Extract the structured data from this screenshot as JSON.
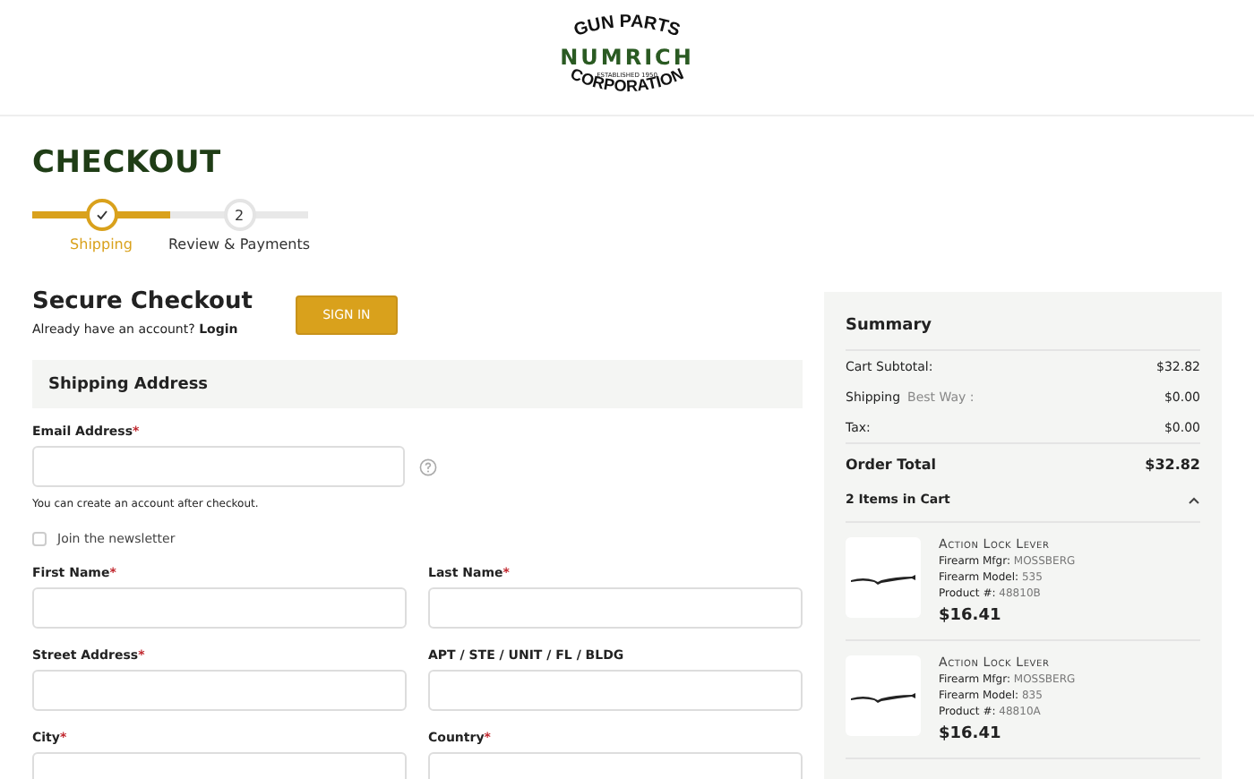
{
  "logo": {
    "top": "GUN PARTS",
    "middle": "NUMRICH",
    "small": "ESTABLISHED 1950",
    "bottom": "CORPORATION"
  },
  "page_title": "CHECKOUT",
  "required_mark": "*",
  "steps": [
    {
      "label": "Shipping",
      "selected": true,
      "done": true
    },
    {
      "label": "Review & Payments",
      "number": "2",
      "selected": false,
      "done": false
    }
  ],
  "secure": {
    "title": "Secure Checkout",
    "prompt": "Already have an account?",
    "link": "Login",
    "button": "SIGN IN"
  },
  "section_title": "Shipping Address",
  "email": {
    "label": "Email Address",
    "required": true,
    "note": "You can create an account after checkout."
  },
  "newsletter": {
    "label": "Join the newsletter",
    "checked": false
  },
  "field_rows": [
    [
      {
        "label": "First Name",
        "required": true
      },
      {
        "label": "Last Name",
        "required": true
      }
    ],
    [
      {
        "label": "Street Address",
        "required": true
      },
      {
        "label": "APT / STE / UNIT / FL / BLDG",
        "required": false
      }
    ],
    [
      {
        "label": "City",
        "required": true
      },
      {
        "label": "Country",
        "required": true
      }
    ]
  ],
  "summary": {
    "title": "Summary",
    "lines": [
      {
        "label": "Cart Subtotal:",
        "value": "$32.82"
      },
      {
        "label": "Shipping",
        "detail": "Best Way :",
        "value": "$0.00"
      },
      {
        "label": "Tax:",
        "value": "$0.00"
      }
    ],
    "total": {
      "label": "Order Total",
      "value": "$32.82"
    },
    "items_heading": "2 Items in Cart",
    "expanded": true,
    "items": [
      {
        "name": "Action Lock Lever",
        "specs": [
          {
            "label": "Firearm Mfgr:",
            "value": "MOSSBERG"
          },
          {
            "label": "Firearm Model:",
            "value": "535"
          },
          {
            "label": "Product #:",
            "value": "48810B"
          }
        ],
        "price": "$16.41"
      },
      {
        "name": "Action Lock Lever",
        "specs": [
          {
            "label": "Firearm Mfgr:",
            "value": "MOSSBERG"
          },
          {
            "label": "Firearm Model:",
            "value": "835"
          },
          {
            "label": "Product #:",
            "value": "48810A"
          }
        ],
        "price": "$16.41"
      }
    ]
  }
}
